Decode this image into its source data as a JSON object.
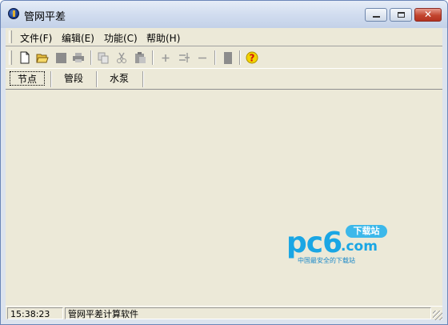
{
  "window": {
    "title": "管网平差",
    "close_glyph": "✕"
  },
  "menu": [
    {
      "label": "文件(F)"
    },
    {
      "label": "编辑(E)"
    },
    {
      "label": "功能(C)"
    },
    {
      "label": "帮助(H)"
    }
  ],
  "toolbar": {
    "icons": [
      "new-file-icon",
      "open-folder-icon",
      "save-icon",
      "print-icon",
      "copy-icon",
      "cut-icon",
      "paste-icon",
      "add-icon",
      "insert-icon",
      "remove-icon",
      "calculate-icon",
      "help-icon"
    ]
  },
  "tabs": [
    {
      "label": "节点",
      "active": true
    },
    {
      "label": "管段",
      "active": false
    },
    {
      "label": "水泵",
      "active": false
    }
  ],
  "status": {
    "time": "15:38:23",
    "text": "管网平差计算软件"
  },
  "watermark": {
    "logo": "pc6",
    "domain": ".com",
    "badge": "下载站",
    "tagline": "中国最安全的下载站"
  },
  "colors": {
    "title_gradient_top": "#e6edf7",
    "face": "#ece9d8",
    "watermark_blue": "#1aa6e4",
    "help_yellow": "#f2d400",
    "help_red": "#d01010"
  }
}
